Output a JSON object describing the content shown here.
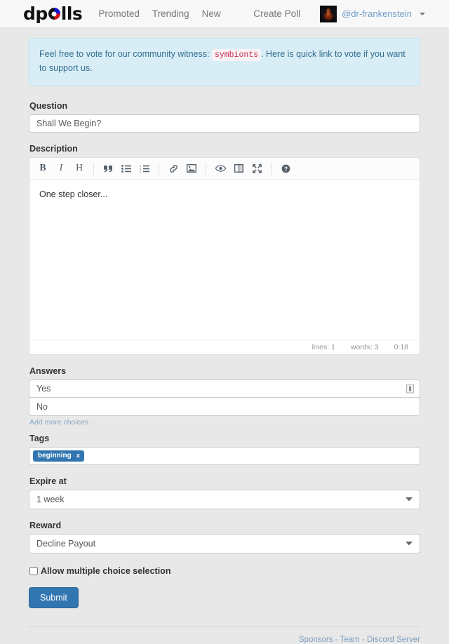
{
  "navbar": {
    "brand_prefix": "dp",
    "brand_suffix": "lls",
    "links": [
      {
        "label": "Promoted",
        "name": "nav-link-promoted"
      },
      {
        "label": "Trending",
        "name": "nav-link-trending"
      },
      {
        "label": "New",
        "name": "nav-link-new"
      }
    ],
    "create_poll_label": "Create Poll",
    "username": "@dr-frankenstein"
  },
  "alert": {
    "text_before": "Feel free to vote for our community witness:",
    "witness": "symbionts",
    "text_after": ".",
    "link_text": "Here is quick link to vote",
    "text_end": "if you want to support us."
  },
  "form": {
    "question_label": "Question",
    "question_value": "Shall We Begin?",
    "question_placeholder": "",
    "description_label": "Description",
    "description_value": "One step closer...",
    "answers_label": "Answers",
    "answers": [
      {
        "value": "Yes"
      },
      {
        "value": "No"
      }
    ],
    "add_more_label": "Add more choices",
    "tags_label": "Tags",
    "tags": [
      {
        "label": "beginning",
        "remove": "x"
      }
    ],
    "expire_label": "Expire at",
    "expire_value": "1 week",
    "expire_options": [
      "1 week"
    ],
    "reward_label": "Reward",
    "reward_value": "Decline Payout",
    "reward_options": [
      "Decline Payout"
    ],
    "multiple_choice_label": "Allow multiple choice selection",
    "submit_label": "Submit"
  },
  "editor": {
    "toolbar": [
      {
        "name": "bold-icon",
        "title": "Bold",
        "glyph": "B"
      },
      {
        "name": "italic-icon",
        "title": "Italic",
        "glyph": "I"
      },
      {
        "name": "heading-icon",
        "title": "Heading",
        "glyph": "H"
      },
      {
        "name": "quote-icon",
        "title": "Quote"
      },
      {
        "name": "unordered-list-icon",
        "title": "Generic List"
      },
      {
        "name": "ordered-list-icon",
        "title": "Numbered List"
      },
      {
        "name": "link-icon",
        "title": "Create Link"
      },
      {
        "name": "image-icon",
        "title": "Insert Image"
      },
      {
        "name": "preview-icon",
        "title": "Toggle Preview"
      },
      {
        "name": "side-by-side-icon",
        "title": "Toggle Side by Side"
      },
      {
        "name": "fullscreen-icon",
        "title": "Toggle Fullscreen"
      },
      {
        "name": "help-icon",
        "title": "Markdown Guide"
      }
    ],
    "status_lines": "lines: 1",
    "status_words": "words: 3",
    "status_time": "0:18"
  },
  "footer": {
    "sponsors": "Sponsors",
    "sep1": "-",
    "team": "Team",
    "sep2": "-",
    "discord": "Discord Server"
  },
  "colors": {
    "brand_blue": "#3276b1",
    "alert_bg": "#d9edf7",
    "alert_border": "#bce8f1",
    "alert_text": "#31708f",
    "witness_text": "#c7254e",
    "link": "#7f9fbe",
    "page_bg": "#e8e8e8"
  }
}
